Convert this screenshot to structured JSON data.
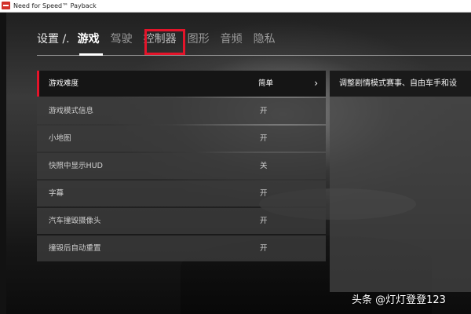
{
  "window": {
    "title": "Need for Speed™ Payback",
    "icon": "nfs-app-icon"
  },
  "nav": {
    "section": "设置 /.",
    "tabs": [
      {
        "label": "游戏",
        "active": true
      },
      {
        "label": "驾驶"
      },
      {
        "label": "控制器",
        "highlighted": true
      },
      {
        "label": "图形"
      },
      {
        "label": "音频"
      },
      {
        "label": "隐私"
      }
    ]
  },
  "settings": [
    {
      "label": "游戏难度",
      "value": "简单",
      "active": true,
      "chevron": "›"
    },
    {
      "label": "游戏模式信息",
      "value": "开"
    },
    {
      "label": "小地图",
      "value": "开"
    },
    {
      "label": "快照中显示HUD",
      "value": "关"
    },
    {
      "label": "字幕",
      "value": "开"
    },
    {
      "label": "汽车撞毁摄像头",
      "value": "开"
    },
    {
      "label": "撞毁后自动重置",
      "value": "开"
    }
  ],
  "description": {
    "text": "调整剧情模式赛事、自由车手和设"
  },
  "watermark": "头条 @灯灯登登123",
  "colors": {
    "accent": "#e4142a"
  }
}
